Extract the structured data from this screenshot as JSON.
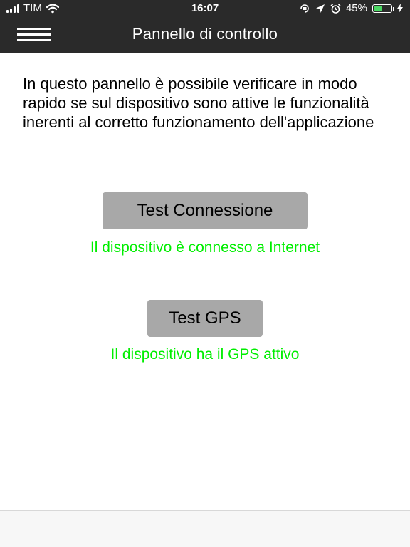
{
  "status_bar": {
    "carrier": "TIM",
    "time": "16:07",
    "battery_percent": "45%",
    "battery_level": 0.45,
    "icons": [
      "signal-bars-icon",
      "wifi-icon",
      "screen-rotation-lock-icon",
      "location-arrow-icon",
      "alarm-clock-icon",
      "battery-icon",
      "charging-bolt-icon"
    ],
    "battery_color": "#4cd964"
  },
  "header": {
    "menu_icon": "hamburger-menu-icon",
    "title": "Pannello di controllo",
    "background": "#2a2a2a"
  },
  "main": {
    "intro": "In questo pannello è possibile verificare in modo rapido se sul dispositivo sono attive le funzionalità inerenti al corretto funzionamento dell'applicazione",
    "connection_test": {
      "button_label": "Test Connessione",
      "result": "Il dispositivo è connesso a Internet"
    },
    "gps_test": {
      "button_label": "Test GPS",
      "result": "Il dispositivo ha il GPS attivo"
    },
    "result_color": "#00ee00",
    "button_color": "#a8a8a8"
  }
}
